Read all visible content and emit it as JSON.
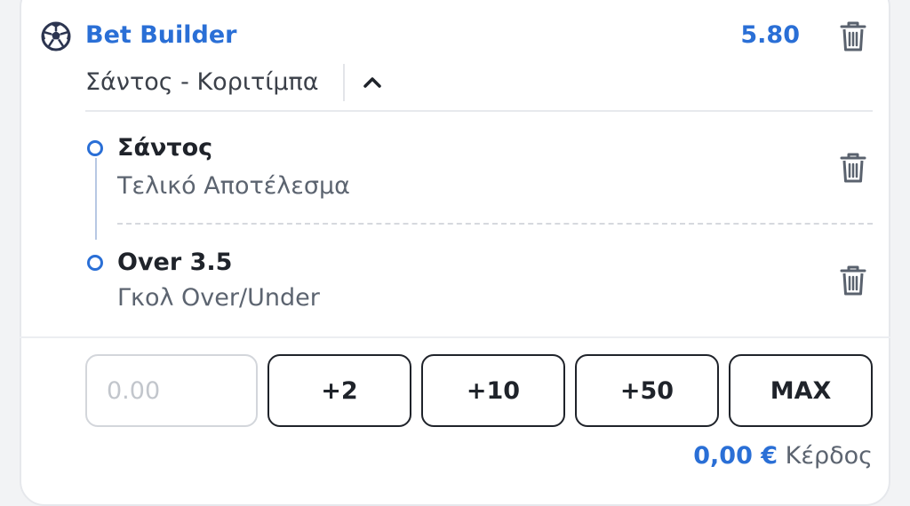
{
  "header": {
    "title": "Bet Builder",
    "odds": "5.80",
    "match": "Σάντος - Κοριτίμπα"
  },
  "selections": [
    {
      "title": "Σάντος",
      "market": "Τελικό Αποτέλεσμα"
    },
    {
      "title": "Over 3.5",
      "market": "Γκολ Over/Under"
    }
  ],
  "stake": {
    "placeholder": "0.00",
    "value": ""
  },
  "quick_stakes": [
    "+2",
    "+10",
    "+50",
    "MAX"
  ],
  "profit": {
    "amount": "0,00 €",
    "label": "Κέρδος"
  },
  "colors": {
    "accent": "#2a6fd6",
    "text": "#1f232a",
    "muted": "#5c6470",
    "border": "#d3d6db"
  },
  "icons": [
    "soccer-ball-icon",
    "trash-icon",
    "chevron-up-icon"
  ]
}
